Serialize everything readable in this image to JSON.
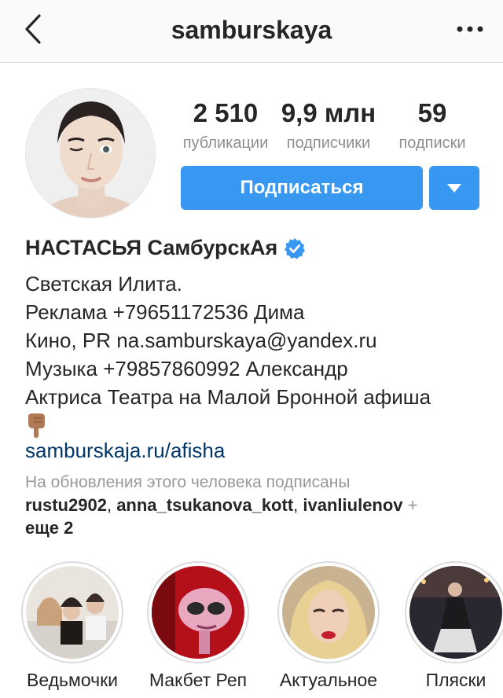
{
  "header": {
    "title": "samburskaya"
  },
  "stats": [
    {
      "value": "2 510",
      "label": "публикации"
    },
    {
      "value": "9,9 млн",
      "label": "подписчики"
    },
    {
      "value": "59",
      "label": "подписки"
    }
  ],
  "actions": {
    "subscribe_label": "Подписаться"
  },
  "profile": {
    "name": "НАСТАСЬЯ СамбурскАя",
    "bio_lines": [
      "Светская Илита.",
      "Реклама +79651172536 Дима",
      "Кино, PR na.samburskaya@yandex.ru",
      "Музыка +79857860992 Александр",
      "Актриса Театра на Малой Бронной афиша"
    ],
    "bio_emoji_icon": "pointing-down-hand-icon",
    "link": "samburskaja.ru/afisha"
  },
  "followed_by": {
    "caption": "На обновления этого человека подписаны",
    "users": [
      "rustu2902",
      "anna_tsukanova_kott",
      "ivanliulenov"
    ],
    "separator": ", ",
    "plus": "+",
    "more": "еще 2"
  },
  "highlights": [
    {
      "label": "Ведьмочки"
    },
    {
      "label": "Макбет Реп"
    },
    {
      "label": "Актуальное"
    },
    {
      "label": "Пляски"
    }
  ],
  "colors": {
    "accent": "#3897f0",
    "link": "#003569",
    "muted": "#8e8e8e",
    "verified": "#3897f0"
  }
}
